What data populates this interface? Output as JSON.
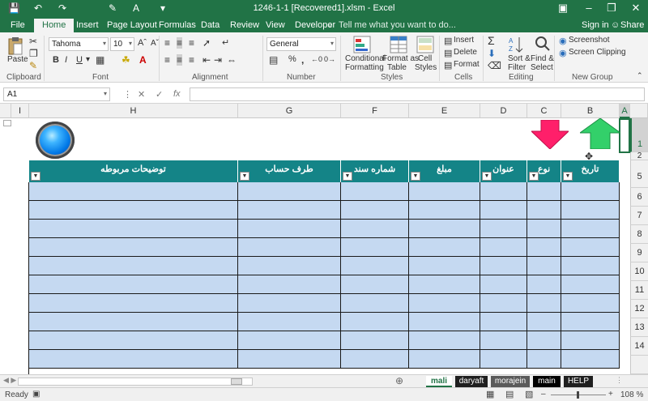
{
  "app": {
    "title": "1246-1-1 [Recovered1].xlsm - Excel"
  },
  "ribbon_tabs": [
    "File",
    "Home",
    "Insert",
    "Page Layout",
    "Formulas",
    "Data",
    "Review",
    "View",
    "Developer"
  ],
  "tell_me": "Tell me what you want to do...",
  "account": {
    "signin": "Sign in",
    "share": "Share"
  },
  "groups": {
    "clipboard": {
      "label": "Clipboard",
      "paste": "Paste"
    },
    "font": {
      "label": "Font",
      "name": "Tahoma",
      "size": "10",
      "bold": "B",
      "italic": "I",
      "underline": "U"
    },
    "alignment": {
      "label": "Alignment"
    },
    "number": {
      "label": "Number",
      "format": "General",
      "percent": "%",
      "comma": ","
    },
    "styles": {
      "label": "Styles",
      "conditional": "Conditional",
      "conditional2": "Formatting",
      "format_as": "Format as",
      "format_as2": "Table",
      "cell": "Cell",
      "cell2": "Styles"
    },
    "cells": {
      "label": "Cells",
      "insert": "Insert",
      "delete": "Delete",
      "format": "Format"
    },
    "editing": {
      "label": "Editing",
      "sort": "Sort &",
      "sort2": "Filter",
      "find": "Find &",
      "find2": "Select"
    },
    "new_group": {
      "label": "New Group",
      "screenshot": "Screenshot",
      "clipping": "Screen Clipping"
    }
  },
  "formula_bar": {
    "name_box": "A1",
    "fx": "fx",
    "value": ""
  },
  "columns": [
    "I",
    "H",
    "G",
    "F",
    "E",
    "D",
    "C",
    "B",
    "A"
  ],
  "rows": [
    "1",
    "2",
    "5",
    "6",
    "7",
    "8",
    "9",
    "10",
    "11",
    "12",
    "13",
    "14"
  ],
  "table_headers": [
    "توضيحات مربوطه",
    "طرف حساب",
    "شماره سند",
    "مبلغ",
    "عنوان",
    "نوع",
    "تاريخ"
  ],
  "sheet_tabs": [
    "mali",
    "daryaft",
    "morajein",
    "main",
    "HELP"
  ],
  "status": {
    "ready": "Ready",
    "zoom": "108 %"
  },
  "colors": {
    "excel_green": "#217346",
    "table_header": "#148487",
    "table_fill": "#c5d9f1"
  }
}
